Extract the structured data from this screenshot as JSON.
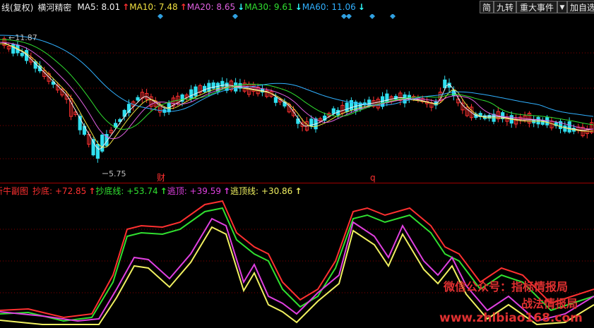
{
  "top": {
    "period": "日线(复权)",
    "stock": "横河精密",
    "ma": [
      {
        "label": "MA5:",
        "value": "8.01",
        "arrow": "↑",
        "color": "#f0f0f0",
        "arrow_color": "#ff3030"
      },
      {
        "label": "MA10:",
        "value": "7.48",
        "arrow": "↑",
        "color": "#f0e040",
        "arrow_color": "#ff3030"
      },
      {
        "label": "MA20:",
        "value": "8.65",
        "arrow": "↓",
        "color": "#e060e0",
        "arrow_color": "#30ffff"
      },
      {
        "label": "MA30:",
        "value": "9.61",
        "arrow": "↓",
        "color": "#30e030",
        "arrow_color": "#30ffff"
      },
      {
        "label": "MA60:",
        "value": "11.06",
        "arrow": "↓",
        "color": "#30b0ff",
        "arrow_color": "#30ffff"
      }
    ],
    "buttons": {
      "simple": "简",
      "nine": "九转",
      "events": "重大事件",
      "dropdown": "▼",
      "add": "加自选"
    }
  },
  "sub": {
    "name": "新牛副图",
    "items": [
      {
        "label": "抄底:",
        "value": "+72.85",
        "arrow": "↑",
        "color": "#ff3030"
      },
      {
        "label": "抄底线:",
        "value": "+53.74",
        "arrow": "↑",
        "color": "#30e030"
      },
      {
        "label": "逃顶:",
        "value": "+39.59",
        "arrow": "↑",
        "color": "#e040e0"
      },
      {
        "label": "逃顶线:",
        "value": "+30.86",
        "arrow": "↑",
        "color": "#f0f060"
      }
    ]
  },
  "annotations": {
    "high": "11.87",
    "low": "5.75",
    "cai": "财",
    "q": "q"
  },
  "watermark": {
    "line1": "微信公众号：指标情报局",
    "line2": "战法情报局",
    "url": "www.zhibiao168.com"
  },
  "colors": {
    "up": "#ff3030",
    "down": "#30e0f0",
    "ma5": "#f0f0f0",
    "ma10": "#f0e040",
    "ma20": "#e060e0",
    "ma30": "#30e030",
    "ma60": "#30b0ff",
    "grid": "#8a0000"
  }
}
